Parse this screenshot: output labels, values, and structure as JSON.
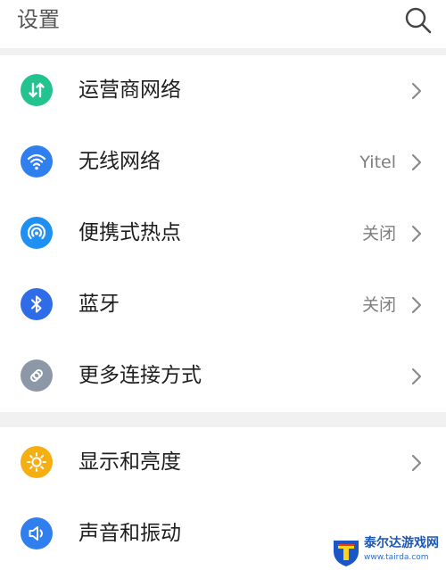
{
  "header": {
    "title": "设置",
    "search_icon": "search-icon"
  },
  "settings": [
    {
      "label": "运营商网络",
      "value": "",
      "icon": "mobile-data-icon",
      "color": "#23c38f"
    },
    {
      "label": "无线网络",
      "value": "Yitel",
      "icon": "wifi-icon",
      "color": "#2f7fef"
    },
    {
      "label": "便携式热点",
      "value": "关闭",
      "icon": "hotspot-icon",
      "color": "#1f8ff2"
    },
    {
      "label": "蓝牙",
      "value": "关闭",
      "icon": "bluetooth-icon",
      "color": "#2f6ce8"
    },
    {
      "label": "更多连接方式",
      "value": "",
      "icon": "link-icon",
      "color": "#8c98a8"
    },
    {
      "label": "显示和亮度",
      "value": "",
      "icon": "brightness-icon",
      "color": "#f7ae13"
    },
    {
      "label": "声音和振动",
      "value": "",
      "icon": "volume-icon",
      "color": "#2f7fef"
    }
  ],
  "watermark": {
    "text": "泰尔达游戏网",
    "url": "www.tairda.com"
  }
}
